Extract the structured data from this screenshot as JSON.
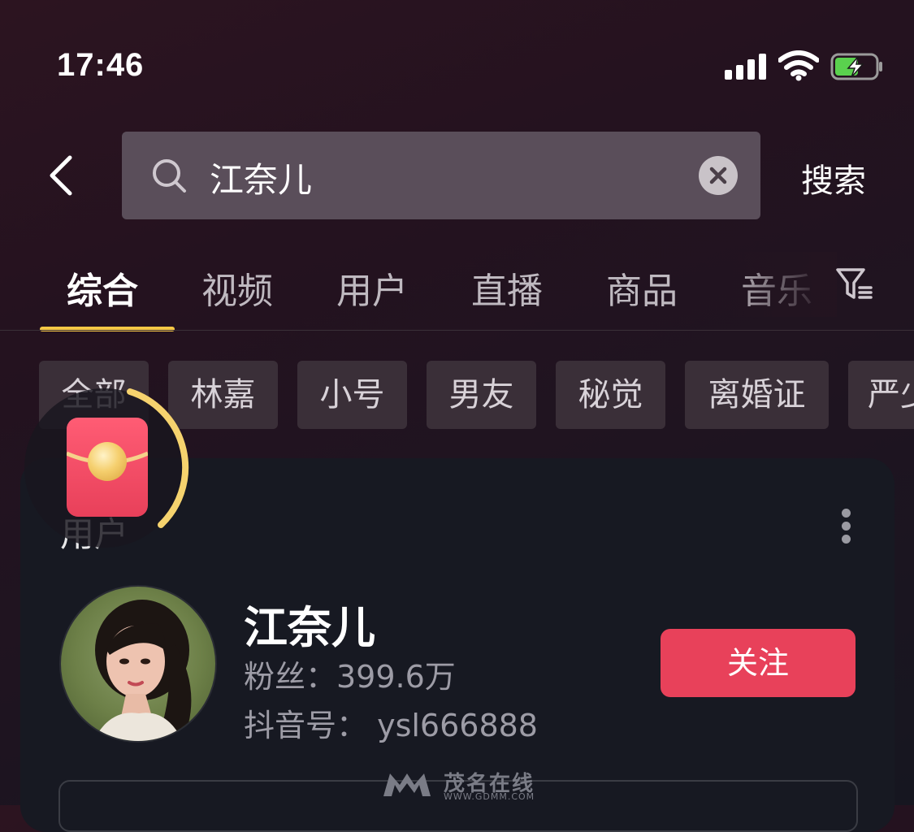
{
  "status_bar": {
    "time": "17:46"
  },
  "search": {
    "query": "江奈儿",
    "action_label": "搜索"
  },
  "tabs": [
    {
      "label": "综合",
      "active": true
    },
    {
      "label": "视频"
    },
    {
      "label": "用户"
    },
    {
      "label": "直播"
    },
    {
      "label": "商品"
    },
    {
      "label": "音乐"
    }
  ],
  "chips": [
    "全部",
    "林嘉",
    "小号",
    "男友",
    "秘觉",
    "离婚证",
    "严少"
  ],
  "user_section": {
    "title": "用户",
    "user": {
      "name": "江奈儿",
      "fans": "粉丝：399.6万",
      "douyin_id": "抖音号： ysl666888"
    },
    "follow_label": "关注"
  },
  "watermark": {
    "text": "茂名在线",
    "url": "WWW.GDMM.COM"
  },
  "colors": {
    "accent_yellow": "#f6c845",
    "follow_red": "#e8415a"
  }
}
